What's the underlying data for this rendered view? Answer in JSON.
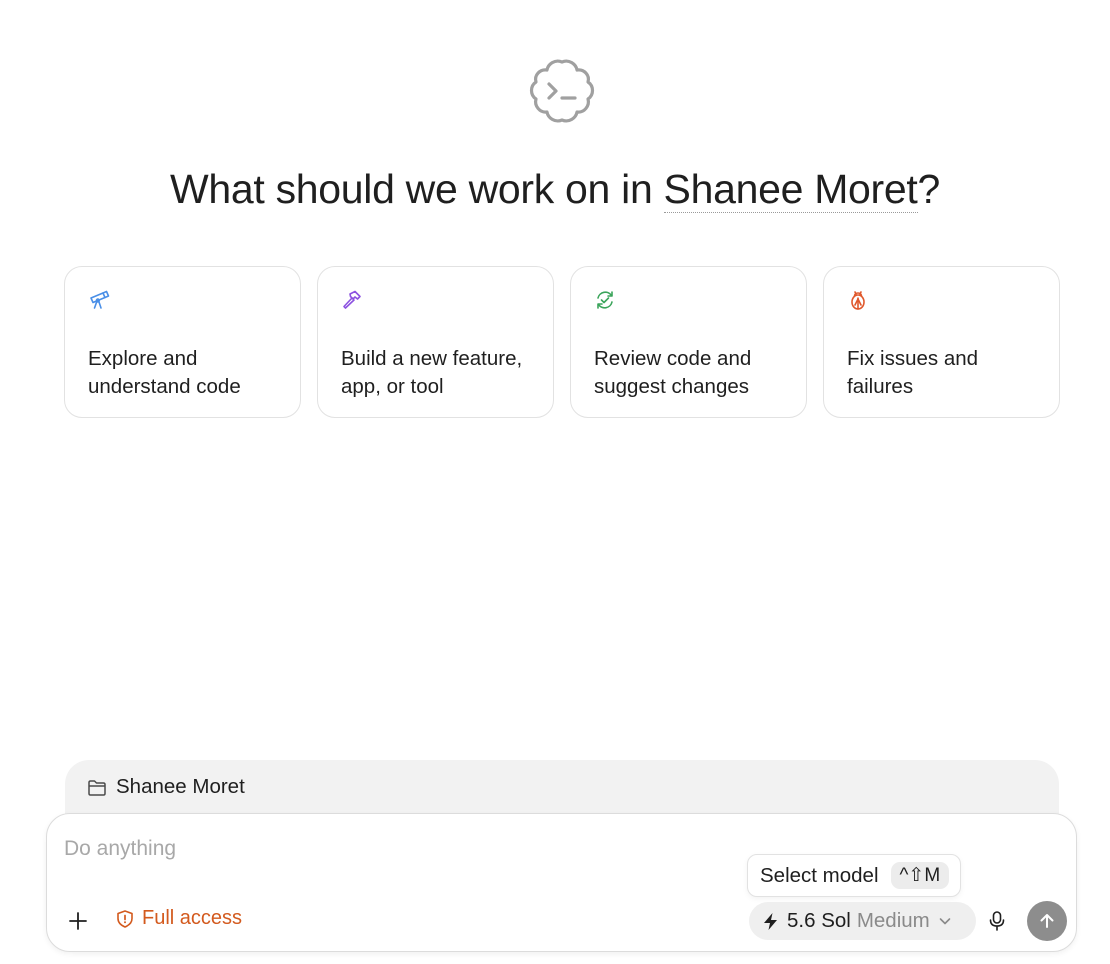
{
  "header": {
    "question_prefix": "What should we work on in",
    "project_name": "Shanee Moret",
    "question_suffix": "?"
  },
  "suggestions": [
    {
      "label": "Explore and understand code",
      "icon": "telescope-icon",
      "color": "#4a8fe7"
    },
    {
      "label": "Build a new feature, app, or tool",
      "icon": "hammer-icon",
      "color": "#8c52e0"
    },
    {
      "label": "Review code and suggest changes",
      "icon": "review-cycle-icon",
      "color": "#3aa45a"
    },
    {
      "label": "Fix issues and failures",
      "icon": "bug-icon",
      "color": "#e0582c"
    }
  ],
  "workspace": {
    "folder_name": "Shanee Moret"
  },
  "composer": {
    "placeholder": "Do anything",
    "value": "",
    "access_label": "Full access",
    "tooltip_label": "Select model",
    "tooltip_shortcut": "^⇧M",
    "model_name": "5.6 Sol",
    "model_effort": "Medium"
  },
  "colors": {
    "accent_orange": "#d35a1e",
    "send_button": "#8d8d8d",
    "logo_gray": "#a0a0a0"
  }
}
